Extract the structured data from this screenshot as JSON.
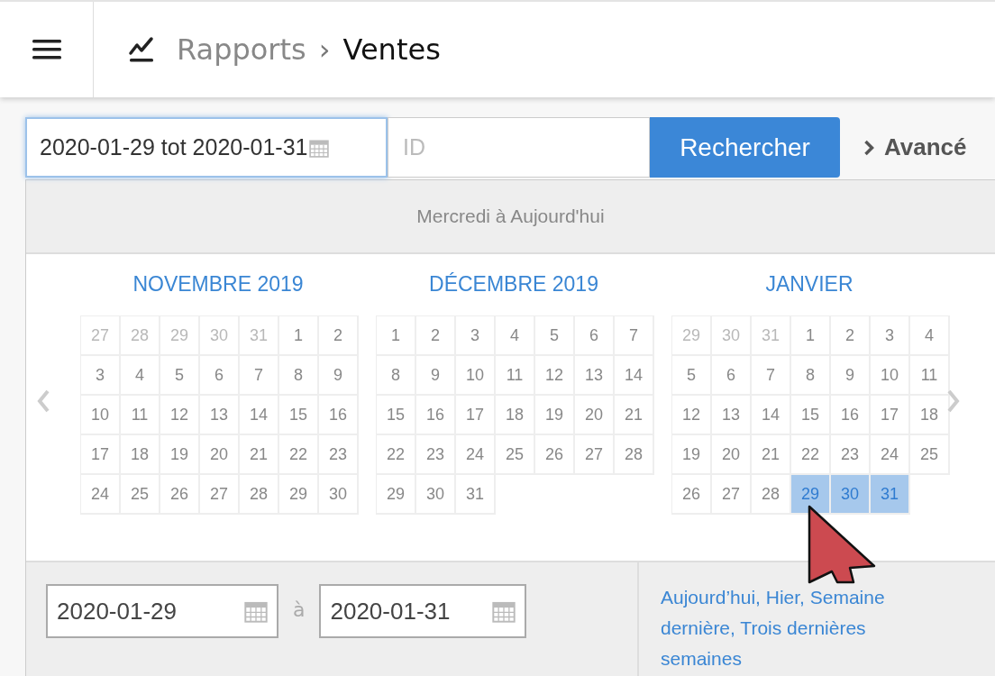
{
  "breadcrumb": {
    "parent": "Rapports",
    "separator": "›",
    "current": "Ventes"
  },
  "search": {
    "range_value": "2020-01-29 tot 2020-01-31",
    "id_placeholder": "ID",
    "button": "Rechercher",
    "advanced": "Avancé"
  },
  "picker": {
    "heading": "Mercredi à Aujourd'hui",
    "months": [
      {
        "title": "NOVEMBRE 2019",
        "days": [
          {
            "d": "27",
            "muted": true,
            "selected": false
          },
          {
            "d": "28",
            "muted": true,
            "selected": false
          },
          {
            "d": "29",
            "muted": true,
            "selected": false
          },
          {
            "d": "30",
            "muted": true,
            "selected": false
          },
          {
            "d": "31",
            "muted": true,
            "selected": false
          },
          {
            "d": "1",
            "muted": false,
            "selected": false
          },
          {
            "d": "2",
            "muted": false,
            "selected": false
          },
          {
            "d": "3",
            "muted": false,
            "selected": false
          },
          {
            "d": "4",
            "muted": false,
            "selected": false
          },
          {
            "d": "5",
            "muted": false,
            "selected": false
          },
          {
            "d": "6",
            "muted": false,
            "selected": false
          },
          {
            "d": "7",
            "muted": false,
            "selected": false
          },
          {
            "d": "8",
            "muted": false,
            "selected": false
          },
          {
            "d": "9",
            "muted": false,
            "selected": false
          },
          {
            "d": "10",
            "muted": false,
            "selected": false
          },
          {
            "d": "11",
            "muted": false,
            "selected": false
          },
          {
            "d": "12",
            "muted": false,
            "selected": false
          },
          {
            "d": "13",
            "muted": false,
            "selected": false
          },
          {
            "d": "14",
            "muted": false,
            "selected": false
          },
          {
            "d": "15",
            "muted": false,
            "selected": false
          },
          {
            "d": "16",
            "muted": false,
            "selected": false
          },
          {
            "d": "17",
            "muted": false,
            "selected": false
          },
          {
            "d": "18",
            "muted": false,
            "selected": false
          },
          {
            "d": "19",
            "muted": false,
            "selected": false
          },
          {
            "d": "20",
            "muted": false,
            "selected": false
          },
          {
            "d": "21",
            "muted": false,
            "selected": false
          },
          {
            "d": "22",
            "muted": false,
            "selected": false
          },
          {
            "d": "23",
            "muted": false,
            "selected": false
          },
          {
            "d": "24",
            "muted": false,
            "selected": false
          },
          {
            "d": "25",
            "muted": false,
            "selected": false
          },
          {
            "d": "26",
            "muted": false,
            "selected": false
          },
          {
            "d": "27",
            "muted": false,
            "selected": false
          },
          {
            "d": "28",
            "muted": false,
            "selected": false
          },
          {
            "d": "29",
            "muted": false,
            "selected": false
          },
          {
            "d": "30",
            "muted": false,
            "selected": false
          }
        ]
      },
      {
        "title": "DÉCEMBRE 2019",
        "days": [
          {
            "d": "1",
            "muted": false,
            "selected": false
          },
          {
            "d": "2",
            "muted": false,
            "selected": false
          },
          {
            "d": "3",
            "muted": false,
            "selected": false
          },
          {
            "d": "4",
            "muted": false,
            "selected": false
          },
          {
            "d": "5",
            "muted": false,
            "selected": false
          },
          {
            "d": "6",
            "muted": false,
            "selected": false
          },
          {
            "d": "7",
            "muted": false,
            "selected": false
          },
          {
            "d": "8",
            "muted": false,
            "selected": false
          },
          {
            "d": "9",
            "muted": false,
            "selected": false
          },
          {
            "d": "10",
            "muted": false,
            "selected": false
          },
          {
            "d": "11",
            "muted": false,
            "selected": false
          },
          {
            "d": "12",
            "muted": false,
            "selected": false
          },
          {
            "d": "13",
            "muted": false,
            "selected": false
          },
          {
            "d": "14",
            "muted": false,
            "selected": false
          },
          {
            "d": "15",
            "muted": false,
            "selected": false
          },
          {
            "d": "16",
            "muted": false,
            "selected": false
          },
          {
            "d": "17",
            "muted": false,
            "selected": false
          },
          {
            "d": "18",
            "muted": false,
            "selected": false
          },
          {
            "d": "19",
            "muted": false,
            "selected": false
          },
          {
            "d": "20",
            "muted": false,
            "selected": false
          },
          {
            "d": "21",
            "muted": false,
            "selected": false
          },
          {
            "d": "22",
            "muted": false,
            "selected": false
          },
          {
            "d": "23",
            "muted": false,
            "selected": false
          },
          {
            "d": "24",
            "muted": false,
            "selected": false
          },
          {
            "d": "25",
            "muted": false,
            "selected": false
          },
          {
            "d": "26",
            "muted": false,
            "selected": false
          },
          {
            "d": "27",
            "muted": false,
            "selected": false
          },
          {
            "d": "28",
            "muted": false,
            "selected": false
          },
          {
            "d": "29",
            "muted": false,
            "selected": false
          },
          {
            "d": "30",
            "muted": false,
            "selected": false
          },
          {
            "d": "31",
            "muted": false,
            "selected": false
          }
        ]
      },
      {
        "title": "JANVIER",
        "days": [
          {
            "d": "29",
            "muted": true,
            "selected": false
          },
          {
            "d": "30",
            "muted": true,
            "selected": false
          },
          {
            "d": "31",
            "muted": true,
            "selected": false
          },
          {
            "d": "1",
            "muted": false,
            "selected": false
          },
          {
            "d": "2",
            "muted": false,
            "selected": false
          },
          {
            "d": "3",
            "muted": false,
            "selected": false
          },
          {
            "d": "4",
            "muted": false,
            "selected": false
          },
          {
            "d": "5",
            "muted": false,
            "selected": false
          },
          {
            "d": "6",
            "muted": false,
            "selected": false
          },
          {
            "d": "7",
            "muted": false,
            "selected": false
          },
          {
            "d": "8",
            "muted": false,
            "selected": false
          },
          {
            "d": "9",
            "muted": false,
            "selected": false
          },
          {
            "d": "10",
            "muted": false,
            "selected": false
          },
          {
            "d": "11",
            "muted": false,
            "selected": false
          },
          {
            "d": "12",
            "muted": false,
            "selected": false
          },
          {
            "d": "13",
            "muted": false,
            "selected": false
          },
          {
            "d": "14",
            "muted": false,
            "selected": false
          },
          {
            "d": "15",
            "muted": false,
            "selected": false
          },
          {
            "d": "16",
            "muted": false,
            "selected": false
          },
          {
            "d": "17",
            "muted": false,
            "selected": false
          },
          {
            "d": "18",
            "muted": false,
            "selected": false
          },
          {
            "d": "19",
            "muted": false,
            "selected": false
          },
          {
            "d": "20",
            "muted": false,
            "selected": false
          },
          {
            "d": "21",
            "muted": false,
            "selected": false
          },
          {
            "d": "22",
            "muted": false,
            "selected": false
          },
          {
            "d": "23",
            "muted": false,
            "selected": false
          },
          {
            "d": "24",
            "muted": false,
            "selected": false
          },
          {
            "d": "25",
            "muted": false,
            "selected": false
          },
          {
            "d": "26",
            "muted": false,
            "selected": false
          },
          {
            "d": "27",
            "muted": false,
            "selected": false
          },
          {
            "d": "28",
            "muted": false,
            "selected": false
          },
          {
            "d": "29",
            "muted": false,
            "selected": true
          },
          {
            "d": "30",
            "muted": false,
            "selected": true
          },
          {
            "d": "31",
            "muted": false,
            "selected": true
          }
        ]
      }
    ],
    "from": "2020-01-29",
    "between": "à",
    "to": "2020-01-31",
    "quick_ranges": "Aujourd’hui, Hier, Semaine dernière, Trois dernières semaines"
  }
}
